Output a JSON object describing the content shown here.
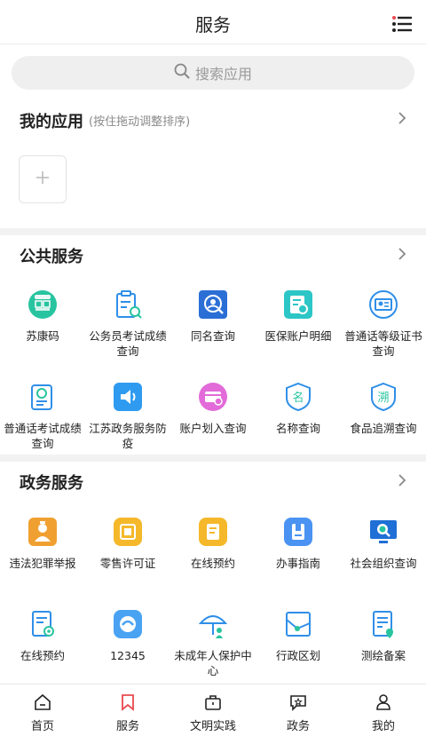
{
  "header": {
    "title": "服务"
  },
  "search": {
    "placeholder": "搜索应用"
  },
  "my_apps": {
    "title": "我的应用",
    "hint": "(按住拖动调整排序)"
  },
  "public": {
    "title": "公共服务",
    "items": [
      {
        "label": "苏康码",
        "icon": "sukangma-icon",
        "badge": "苏康码"
      },
      {
        "label": "公务员考试成绩查询",
        "icon": "clipboard-search-icon"
      },
      {
        "label": "同名查询",
        "icon": "person-search-icon"
      },
      {
        "label": "医保账户明细",
        "icon": "insurance-card-icon"
      },
      {
        "label": "普通话等级证书查询",
        "icon": "certificate-icon"
      },
      {
        "label": "普通话考试成绩查询",
        "icon": "exam-report-icon"
      },
      {
        "label": "江苏政务服务防疫",
        "icon": "speaker-icon"
      },
      {
        "label": "账户划入查询",
        "icon": "account-transfer-icon"
      },
      {
        "label": "名称查询",
        "icon": "name-shield-icon",
        "glyph": "名"
      },
      {
        "label": "食品追溯查询",
        "icon": "trace-shield-icon",
        "glyph": "溯"
      }
    ]
  },
  "gov": {
    "title": "政务服务",
    "items": [
      {
        "label": "违法犯罪举报",
        "icon": "police-report-icon"
      },
      {
        "label": "零售许可证",
        "icon": "license-icon"
      },
      {
        "label": "在线预约",
        "icon": "appointment-icon"
      },
      {
        "label": "办事指南",
        "icon": "guide-book-icon"
      },
      {
        "label": "社会组织查询",
        "icon": "monitor-search-icon"
      },
      {
        "label": "在线预约",
        "icon": "document-gear-icon"
      },
      {
        "label": "12345",
        "icon": "hotline-icon"
      },
      {
        "label": "未成年人保护中心",
        "icon": "umbrella-person-icon"
      },
      {
        "label": "行政区划",
        "icon": "map-region-icon"
      },
      {
        "label": "测绘备案",
        "icon": "survey-doc-icon"
      }
    ]
  },
  "tabbar": {
    "tabs": [
      {
        "label": "首页",
        "icon": "home-icon"
      },
      {
        "label": "服务",
        "icon": "bookmark-icon"
      },
      {
        "label": "文明实践",
        "icon": "briefcase-icon"
      },
      {
        "label": "政务",
        "icon": "chat-star-icon"
      },
      {
        "label": "我的",
        "icon": "profile-icon"
      }
    ],
    "active_color": "#e8494f"
  },
  "colors": {
    "accent": "#2f8fe8",
    "teal": "#2cc6c6",
    "orange": "#f5a623"
  }
}
